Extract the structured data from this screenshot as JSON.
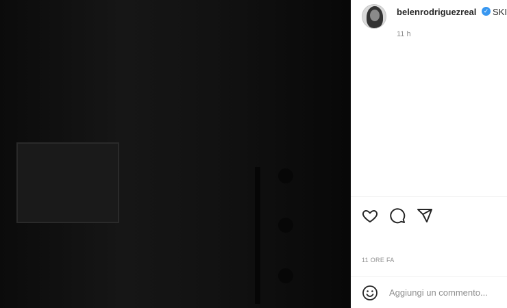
{
  "post": {
    "username": "belenrodriguezreal",
    "verified_icon": "verified-badge-icon",
    "caption_start": "SKII",
    "time_short": "11 h",
    "post_age": "11 ORE FA"
  },
  "actions": {
    "icons": [
      "heart-icon",
      "comment-icon",
      "share-icon"
    ]
  },
  "comment": {
    "placeholder": "Aggiungi un commento...",
    "emoji_icon": "emoji-icon"
  },
  "colors": {
    "accent": "#3897f0",
    "text": "#262626",
    "muted": "#8e8e8e",
    "divider": "#efefef"
  }
}
